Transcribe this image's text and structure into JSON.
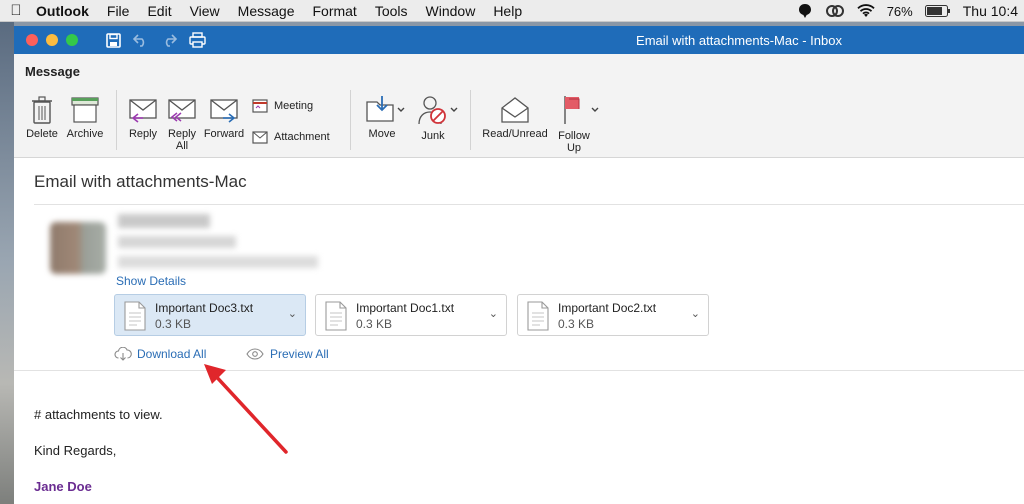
{
  "menubar": {
    "app_name": "Outlook",
    "items": [
      "File",
      "Edit",
      "View",
      "Message",
      "Format",
      "Tools",
      "Window",
      "Help"
    ],
    "battery": "76%",
    "clock": "Thu 10:4"
  },
  "window": {
    "title": "Email with attachments-Mac - Inbox"
  },
  "ribbon": {
    "tab": "Message",
    "delete": "Delete",
    "archive": "Archive",
    "reply": "Reply",
    "reply_all": "Reply All",
    "forward": "Forward",
    "meeting": "Meeting",
    "attachment": "Attachment",
    "move": "Move",
    "junk": "Junk",
    "read_unread": "Read/Unread",
    "follow_up": "Follow Up"
  },
  "message": {
    "subject": "Email with attachments-Mac",
    "show_details": "Show Details",
    "attachments": [
      {
        "name": "Important Doc3.txt",
        "size": "0.3 KB",
        "selected": true
      },
      {
        "name": "Important Doc1.txt",
        "size": "0.3 KB",
        "selected": false
      },
      {
        "name": "Important Doc2.txt",
        "size": "0.3 KB",
        "selected": false
      }
    ],
    "download_all": "Download All",
    "preview_all": "Preview All",
    "body_line1": "# attachments to view.",
    "body_line2": "Kind Regards,",
    "signature": "Jane Doe"
  },
  "colors": {
    "titlebar": "#1f6cb9",
    "link": "#2a6db5",
    "signature": "#6a2c91",
    "annotation_arrow": "#e0262b"
  }
}
